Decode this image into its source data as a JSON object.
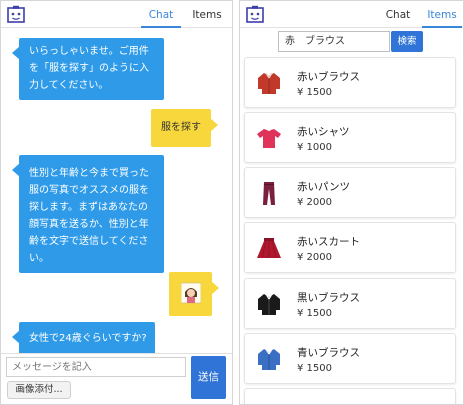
{
  "left_screen": {
    "tabs": [
      {
        "label": "Chat",
        "active": true
      },
      {
        "label": "Items",
        "active": false
      }
    ],
    "messages": [
      {
        "from": "bot",
        "text": "いらっしゃいませ。ご用件を「服を探す」のように入力してください。"
      },
      {
        "from": "user",
        "text": "服を探す"
      },
      {
        "from": "bot",
        "text": "性別と年齢と今まで買った服の写真でオススメの服を探します。まずはあなたの顔写真を送るか、性別と年齢を文字で送信してください。"
      },
      {
        "from": "user",
        "type": "image",
        "icon": "face-photo-icon"
      },
      {
        "from": "bot",
        "text": "女性で24歳ぐらいですか?"
      }
    ],
    "input_placeholder": "メッセージを記入",
    "attach_label": "画像添付...",
    "send_label": "送信"
  },
  "right_screen": {
    "tabs": [
      {
        "label": "Chat",
        "active": false
      },
      {
        "label": "Items",
        "active": true
      }
    ],
    "search_value": "赤　ブラウス",
    "search_button": "検索",
    "items": [
      {
        "name": "赤いブラウス",
        "price": "¥ 1500",
        "icon": "blouse-icon",
        "color": "#c0392b"
      },
      {
        "name": "赤いシャツ",
        "price": "¥ 1000",
        "icon": "tshirt-icon",
        "color": "#e0335a"
      },
      {
        "name": "赤いパンツ",
        "price": "¥ 2000",
        "icon": "pants-icon",
        "color": "#7a1f3d"
      },
      {
        "name": "赤いスカート",
        "price": "¥ 2000",
        "icon": "skirt-icon",
        "color": "#b0182f"
      },
      {
        "name": "黒いブラウス",
        "price": "¥ 1500",
        "icon": "blouse-icon",
        "color": "#1a1a1a"
      },
      {
        "name": "青いブラウス",
        "price": "¥ 1500",
        "icon": "blouse-icon",
        "color": "#3b6fc4"
      }
    ]
  },
  "colors": {
    "accent_blue": "#2f74d6",
    "bot_bubble": "#2f9be8",
    "user_bubble": "#f7d73c"
  }
}
